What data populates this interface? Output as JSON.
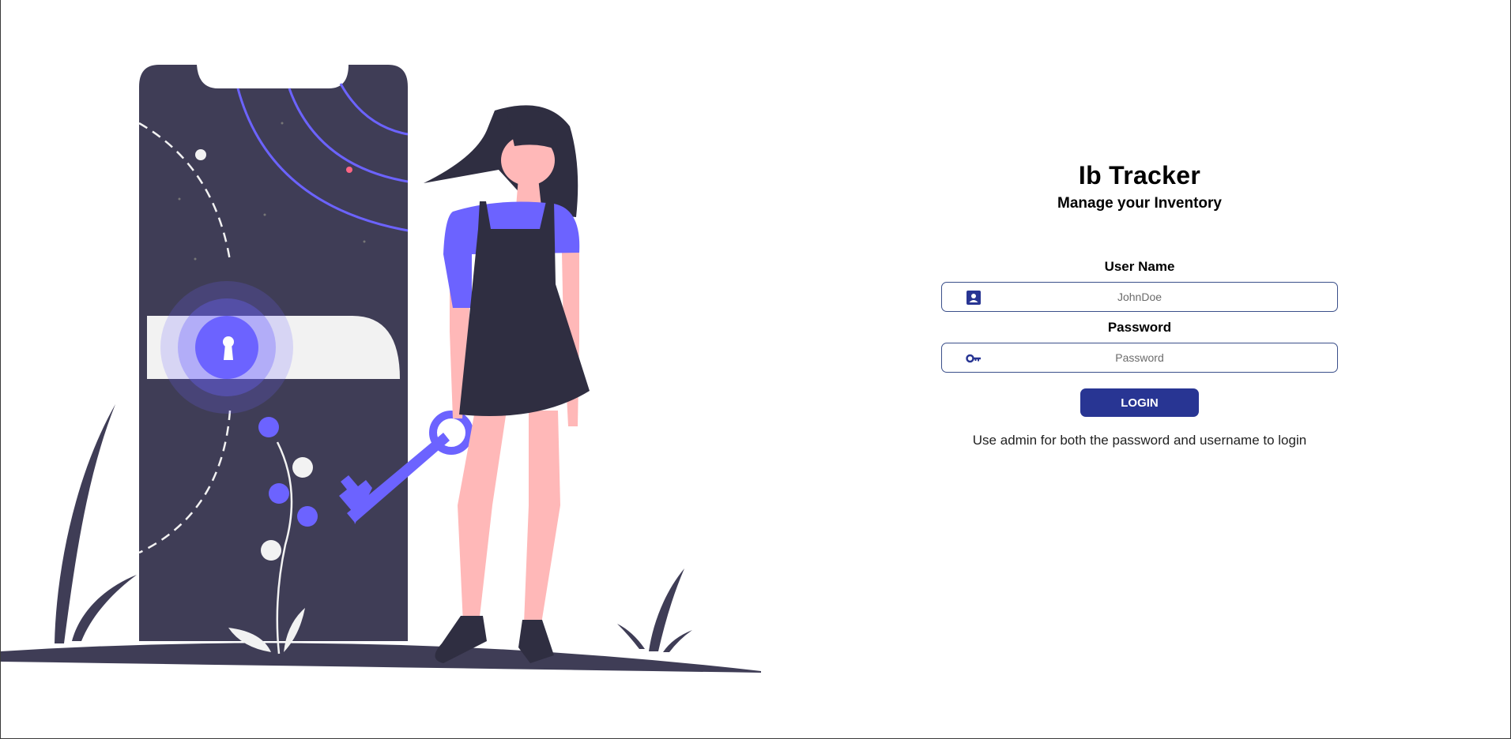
{
  "app": {
    "title": "Ib Tracker",
    "subtitle": "Manage your Inventory"
  },
  "form": {
    "username_label": "User Name",
    "username_placeholder": "JohnDoe",
    "username_value": "",
    "password_label": "Password",
    "password_placeholder": "Password",
    "password_value": "",
    "login_label": "LOGIN",
    "hint": "Use admin for both the password and username to login"
  },
  "icons": {
    "username": "contact-card-icon",
    "password": "key-icon"
  },
  "colors": {
    "primary": "#283593",
    "illustration_dark": "#3f3d56",
    "illustration_accent": "#6c63ff",
    "skin": "#ffb8b8"
  }
}
